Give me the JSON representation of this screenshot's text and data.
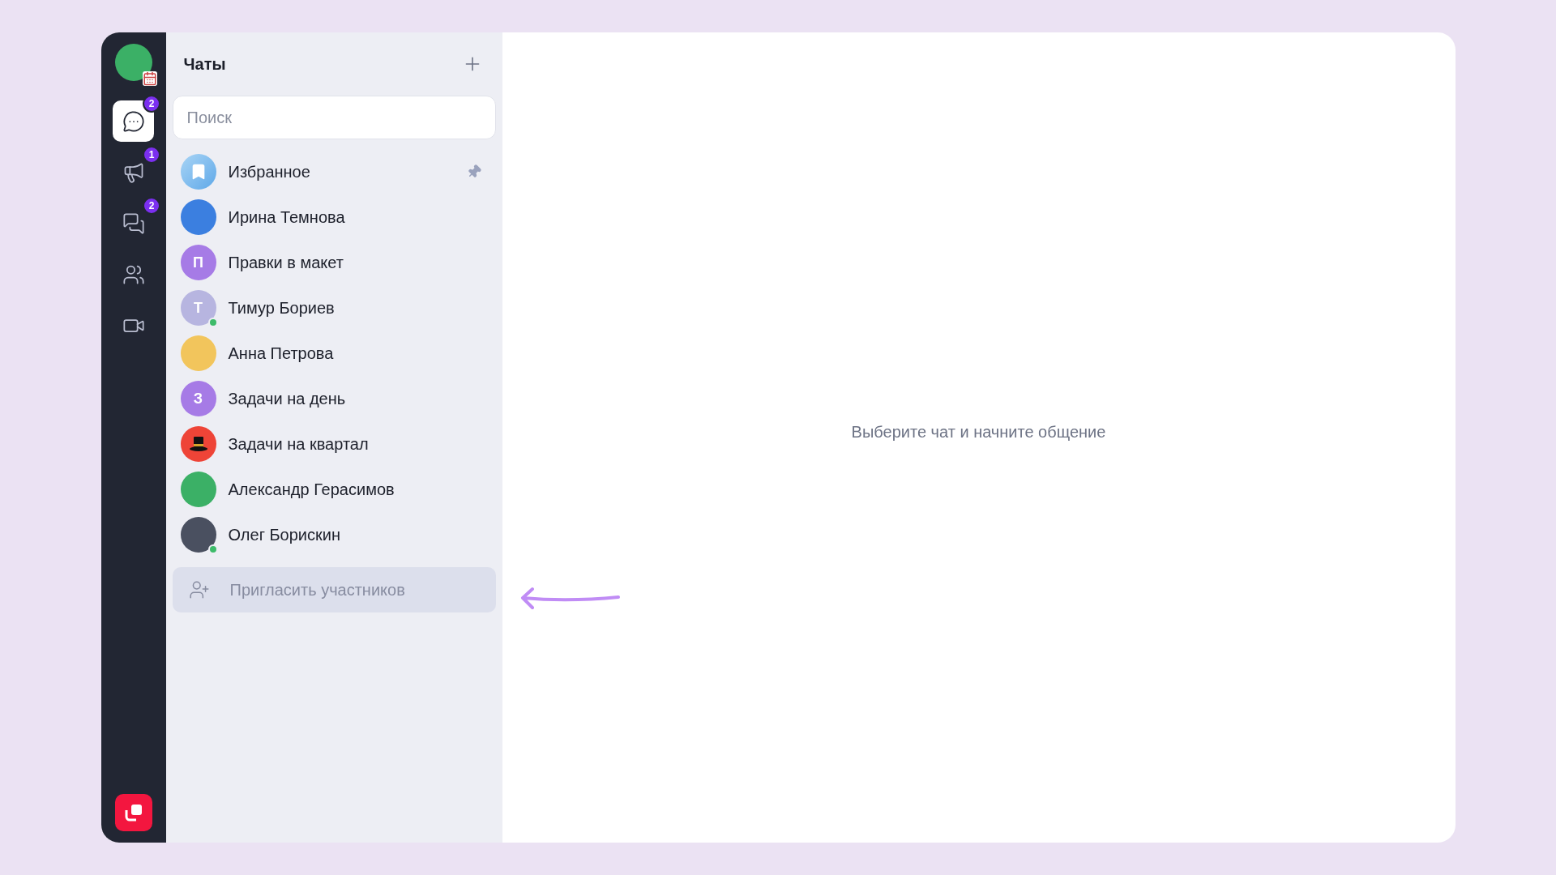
{
  "rail": {
    "items": [
      {
        "kind": "chat",
        "selected": true,
        "badge": "2"
      },
      {
        "kind": "megaphone",
        "selected": false,
        "badge": "1"
      },
      {
        "kind": "threads",
        "selected": false,
        "badge": "2"
      },
      {
        "kind": "people",
        "selected": false
      },
      {
        "kind": "video",
        "selected": false
      }
    ]
  },
  "chats_panel": {
    "title": "Чаты",
    "search": {
      "placeholder": "Поиск"
    },
    "items": [
      {
        "name": "Избранное",
        "kind": "bookmark",
        "pinned": true,
        "online": false
      },
      {
        "name": "Ирина Темнова",
        "kind": "photo",
        "color": "#3b7fe0",
        "pinned": false,
        "online": false
      },
      {
        "name": "Правки в макет",
        "kind": "letter",
        "letter": "П",
        "color": "#a67be6",
        "pinned": false,
        "online": false
      },
      {
        "name": "Тимур Бориев",
        "kind": "letter",
        "letter": "Т",
        "color": "#b7b5e0",
        "pinned": false,
        "online": true
      },
      {
        "name": "Анна Петрова",
        "kind": "photo",
        "color": "#f2c55c",
        "pinned": false,
        "online": false
      },
      {
        "name": "Задачи на день",
        "kind": "letter",
        "letter": "З",
        "color": "#a67be6",
        "pinned": false,
        "online": false
      },
      {
        "name": "Задачи на квартал",
        "kind": "hat",
        "color": "#ee4437",
        "pinned": false,
        "online": false
      },
      {
        "name": "Александр Герасимов",
        "kind": "photo",
        "color": "#3bb066",
        "pinned": false,
        "online": false
      },
      {
        "name": "Олег Борискин",
        "kind": "photo",
        "color": "#4a5060",
        "pinned": false,
        "online": true
      }
    ],
    "invite": "Пригласить участников"
  },
  "main": {
    "empty_text": "Выберите чат и начните общение"
  }
}
